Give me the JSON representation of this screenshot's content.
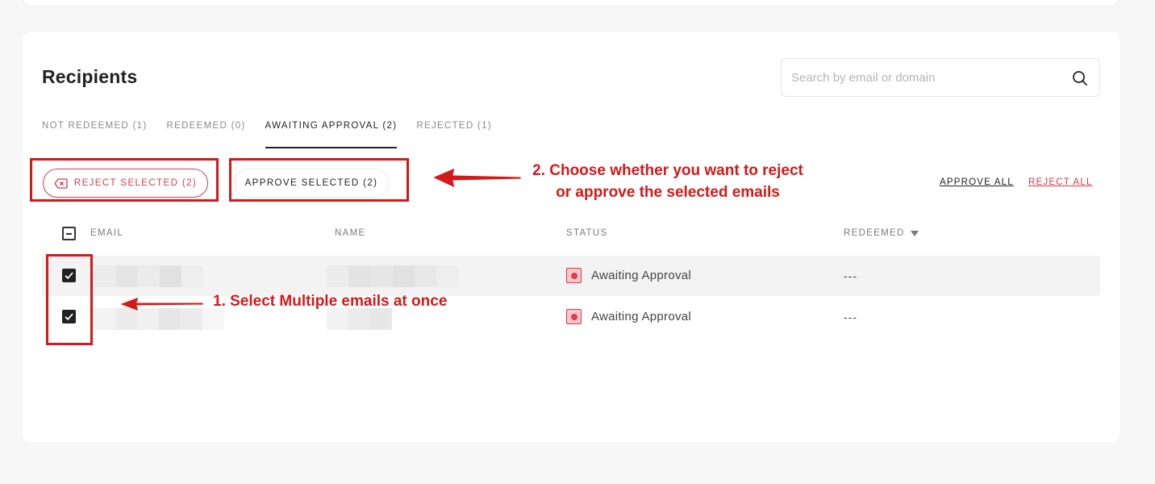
{
  "section": {
    "title": "Recipients"
  },
  "search": {
    "placeholder": "Search by email or domain",
    "icon": "search-icon"
  },
  "tabs": [
    {
      "label": "NOT REDEEMED (1)",
      "active": false
    },
    {
      "label": "REDEEMED (0)",
      "active": false
    },
    {
      "label": "AWAITING APPROVAL (2)",
      "active": true
    },
    {
      "label": "REJECTED (1)",
      "active": false
    }
  ],
  "actions": {
    "reject_selected": "REJECT SELECTED (2)",
    "approve_selected": "APPROVE SELECTED (2)",
    "approve_all": "APPROVE ALL",
    "reject_all": "REJECT ALL"
  },
  "annotations": {
    "step2_line1": "2. Choose whether you want to reject",
    "step2_line2": "or approve the selected emails",
    "step1": "1. Select Multiple emails at once"
  },
  "table": {
    "columns": {
      "email": "EMAIL",
      "name": "NAME",
      "status": "STATUS",
      "redeemed": "REDEEMED"
    },
    "rows": [
      {
        "checked": true,
        "status": "Awaiting Approval",
        "redeemed": "---"
      },
      {
        "checked": true,
        "status": "Awaiting Approval",
        "redeemed": "---"
      }
    ]
  },
  "colors": {
    "accent_red": "#d93a4a",
    "annotation_red": "#d41919"
  }
}
